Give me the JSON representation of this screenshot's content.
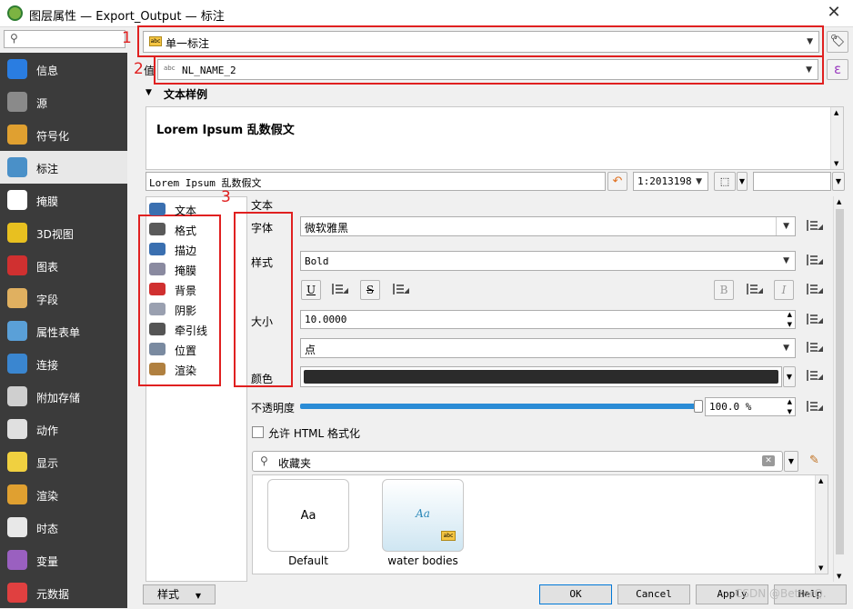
{
  "window": {
    "title": "图层属性 — Export_Output — 标注",
    "close_glyph": "✕"
  },
  "sidebar": {
    "search_placeholder": "",
    "items": [
      {
        "label": "信息",
        "icon": "info-icon",
        "color": "#2a7de1"
      },
      {
        "label": "源",
        "icon": "source-gears-icon",
        "color": "#8a8a8a"
      },
      {
        "label": "符号化",
        "icon": "symbology-brush-icon",
        "color": "#e0a030"
      },
      {
        "label": "标注",
        "icon": "labels-abc-icon",
        "color": "#4a90c8"
      },
      {
        "label": "掩膜",
        "icon": "mask-abc-icon",
        "color": "#ffffff"
      },
      {
        "label": "3D视图",
        "icon": "3d-cube-icon",
        "color": "#e8c020"
      },
      {
        "label": "图表",
        "icon": "diagram-chart-icon",
        "color": "#d03030"
      },
      {
        "label": "字段",
        "icon": "fields-table-icon",
        "color": "#e0b060"
      },
      {
        "label": "属性表单",
        "icon": "attributes-form-icon",
        "color": "#5aa0d8"
      },
      {
        "label": "连接",
        "icon": "joins-arrow-icon",
        "color": "#3a86d0"
      },
      {
        "label": "附加存储",
        "icon": "auxiliary-storage-icon",
        "color": "#cfcfcf"
      },
      {
        "label": "动作",
        "icon": "actions-gear-icon",
        "color": "#e0e0e0"
      },
      {
        "label": "显示",
        "icon": "display-bubble-icon",
        "color": "#f0d040"
      },
      {
        "label": "渲染",
        "icon": "rendering-brush-icon",
        "color": "#e0a030"
      },
      {
        "label": "时态",
        "icon": "temporal-clock-icon",
        "color": "#e8e8e8"
      },
      {
        "label": "变量",
        "icon": "variables-epsilon-icon",
        "color": "#9a60c0"
      },
      {
        "label": "元数据",
        "icon": "metadata-doc-icon",
        "color": "#e04040"
      }
    ]
  },
  "labeling": {
    "mode": "单一标注",
    "mode_num": "1",
    "value_label": "值",
    "value_field": "NL_NAME_2",
    "value_num": "2",
    "epsilon": "ε",
    "section_title": "文本样例",
    "preview_text": "Lorem Ipsum 乱数假文",
    "preview_input": "Lorem Ipsum 乱数假文",
    "scale": "1:2013198",
    "tab_num": "3"
  },
  "tabs": [
    {
      "label": "文本",
      "icon": "text-abc-icon"
    },
    {
      "label": "格式",
      "icon": "formatting-icon"
    },
    {
      "label": "描边",
      "icon": "buffer-abc-icon"
    },
    {
      "label": "掩膜",
      "icon": "mask-abc-icon"
    },
    {
      "label": "背景",
      "icon": "background-shield-icon"
    },
    {
      "label": "阴影",
      "icon": "shadow-circle-icon"
    },
    {
      "label": "牵引线",
      "icon": "callouts-icon"
    },
    {
      "label": "位置",
      "icon": "placement-arrows-icon"
    },
    {
      "label": "渲染",
      "icon": "rendering-brush-icon"
    }
  ],
  "text_panel": {
    "title": "文本",
    "font_label": "字体",
    "font_value": "微软雅黑",
    "style_label": "样式",
    "style_value": "Bold",
    "underline": "U",
    "strike": "S",
    "bold": "B",
    "italic": "I",
    "size_label": "大小",
    "size_value": "10.0000",
    "unit_value": "点",
    "color_label": "颜色",
    "color_value": "#2b2b2b",
    "opacity_label": "不透明度",
    "opacity_value": "100.0 %",
    "opacity_fraction": 1.0,
    "html_label": "允许 HTML 格式化",
    "search_placeholder": "收藏夹",
    "styles": [
      {
        "name": "Default",
        "preview": "Aa"
      },
      {
        "name": "water bodies",
        "preview": "Aa"
      }
    ]
  },
  "footer": {
    "style_button": "样式",
    "ok": "OK",
    "cancel": "Cancel",
    "apply": "Apply",
    "help": "Help",
    "watermark": "CSDN @BetterQ."
  }
}
